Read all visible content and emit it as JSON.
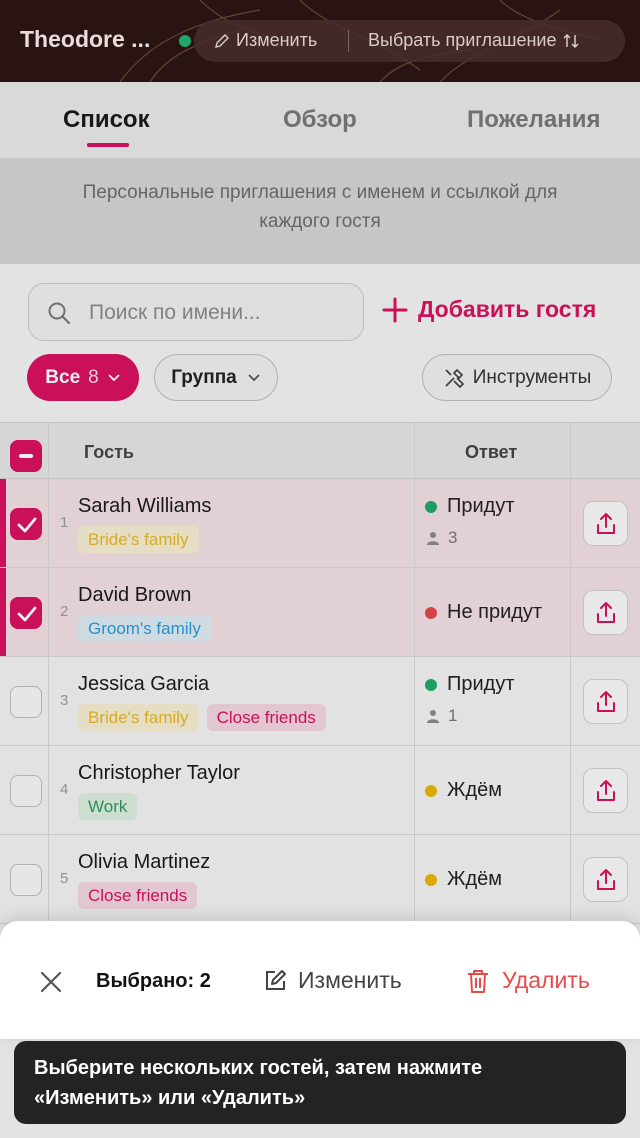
{
  "header": {
    "event_title": "Theodore ...",
    "edit_label": "Изменить",
    "choose_invite_label": "Выбрать приглашение"
  },
  "tabs": [
    {
      "label": "Список",
      "active": true
    },
    {
      "label": "Обзор",
      "active": false
    },
    {
      "label": "Пожелания",
      "active": false
    }
  ],
  "banner": {
    "line1": "Персональные приглашения с именем и ссылкой для",
    "line2": "каждого гостя"
  },
  "search": {
    "placeholder": "Поиск по имени..."
  },
  "add_guest_label": "Добавить гостя",
  "filters": {
    "all_label": "Все",
    "all_count": "8",
    "group_label": "Группа",
    "tools_label": "Инструменты"
  },
  "table": {
    "col_guest": "Гость",
    "col_response": "Ответ",
    "rows": [
      {
        "num": "1",
        "name": "Sarah Williams",
        "tags": [
          "Bride's family"
        ],
        "status": "Придут",
        "count": "3",
        "selected": true
      },
      {
        "num": "2",
        "name": "David Brown",
        "tags": [
          "Groom's family"
        ],
        "status": "Не придут",
        "count": "",
        "selected": true
      },
      {
        "num": "3",
        "name": "Jessica Garcia",
        "tags": [
          "Bride's family",
          "Close friends"
        ],
        "status": "Придут",
        "count": "1",
        "selected": false
      },
      {
        "num": "4",
        "name": "Christopher Taylor",
        "tags": [
          "Work"
        ],
        "status": "Ждём",
        "count": "",
        "selected": false
      },
      {
        "num": "5",
        "name": "Olivia Martinez",
        "tags": [
          "Close friends"
        ],
        "status": "Ждём",
        "count": "",
        "selected": false
      }
    ]
  },
  "selection_bar": {
    "count_text": "Выбрано: 2",
    "edit_label": "Изменить",
    "delete_label": "Удалить"
  },
  "tooltip": {
    "line1": "Выберите нескольких гостей, затем нажмите",
    "line2": "«Изменить» или «Удалить»"
  },
  "colors": {
    "accent": "#d6115e",
    "status_yes": "#1ea86a",
    "status_no": "#e04848",
    "status_wait": "#e6b400",
    "tag_bride_bg": "#f4ecd2",
    "tag_bride_fg": "#e3b62a",
    "tag_groom_bg": "#dce9f2",
    "tag_groom_fg": "#2b9ad6",
    "tag_friends_bg": "#f2d4de",
    "tag_friends_fg": "#d6115e",
    "tag_work_bg": "#d9ecdf",
    "tag_work_fg": "#2d9a5a"
  },
  "icons": {
    "edit": "pencil-icon",
    "sort": "sort-arrows-icon",
    "search": "search-icon",
    "add": "plus-icon",
    "tools": "tools-icon",
    "share": "share-icon",
    "close": "close-icon",
    "delete": "trash-icon",
    "person": "person-icon"
  }
}
